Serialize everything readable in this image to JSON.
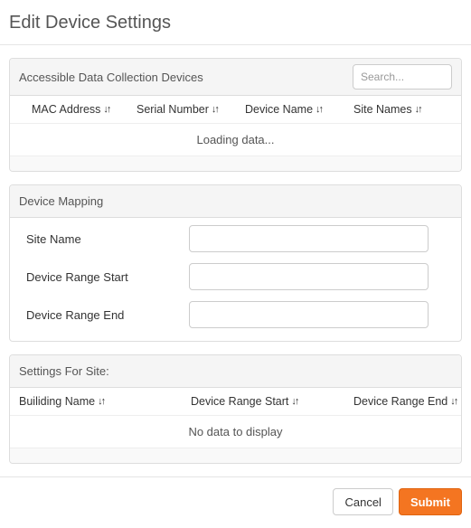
{
  "title": "Edit Device Settings",
  "devices_panel": {
    "header": "Accessible Data Collection Devices",
    "search_placeholder": "Search...",
    "columns": {
      "mac": "MAC Address",
      "serial": "Serial Number",
      "device_name": "Device Name",
      "site_names": "Site Names"
    },
    "loading_text": "Loading data..."
  },
  "mapping_panel": {
    "header": "Device Mapping",
    "fields": {
      "site_name": "Site Name",
      "range_start": "Device Range Start",
      "range_end": "Device Range End"
    }
  },
  "settings_panel": {
    "header": "Settings For Site:",
    "columns": {
      "building": "Builiding Name",
      "range_start": "Device Range Start",
      "range_end": "Device Range End"
    },
    "empty_text": "No data to display"
  },
  "buttons": {
    "cancel": "Cancel",
    "submit": "Submit"
  }
}
